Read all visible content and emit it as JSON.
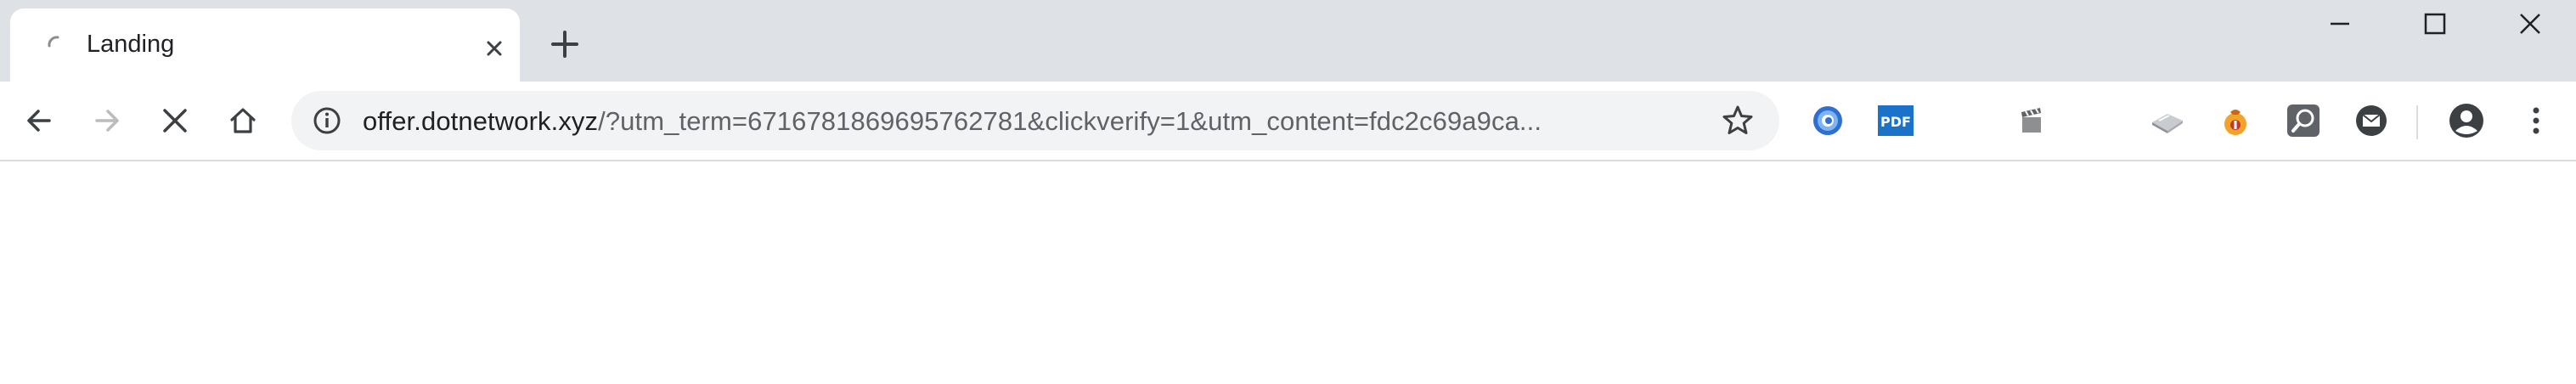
{
  "tab": {
    "title": "Landing"
  },
  "address_bar": {
    "host": "offer.dotnetwork.xyz",
    "path": "/?utm_term=6716781869695762781&clickverify=1&utm_content=fdc2c69a9ca..."
  },
  "extensions": [
    {
      "name": "globe-extension-icon"
    },
    {
      "name": "pdf-extension-icon",
      "label": "PDF"
    },
    {
      "name": "clapperboard-extension-icon"
    },
    {
      "name": "card-extension-icon"
    },
    {
      "name": "money-bag-extension-icon"
    },
    {
      "name": "magnifier-extension-icon"
    },
    {
      "name": "mail-extension-icon"
    }
  ],
  "colors": {
    "tabstrip": "#dee1e6",
    "omnibox": "#f1f3f4",
    "icon": "#5f6368",
    "pdf_blue": "#1a73c8"
  }
}
